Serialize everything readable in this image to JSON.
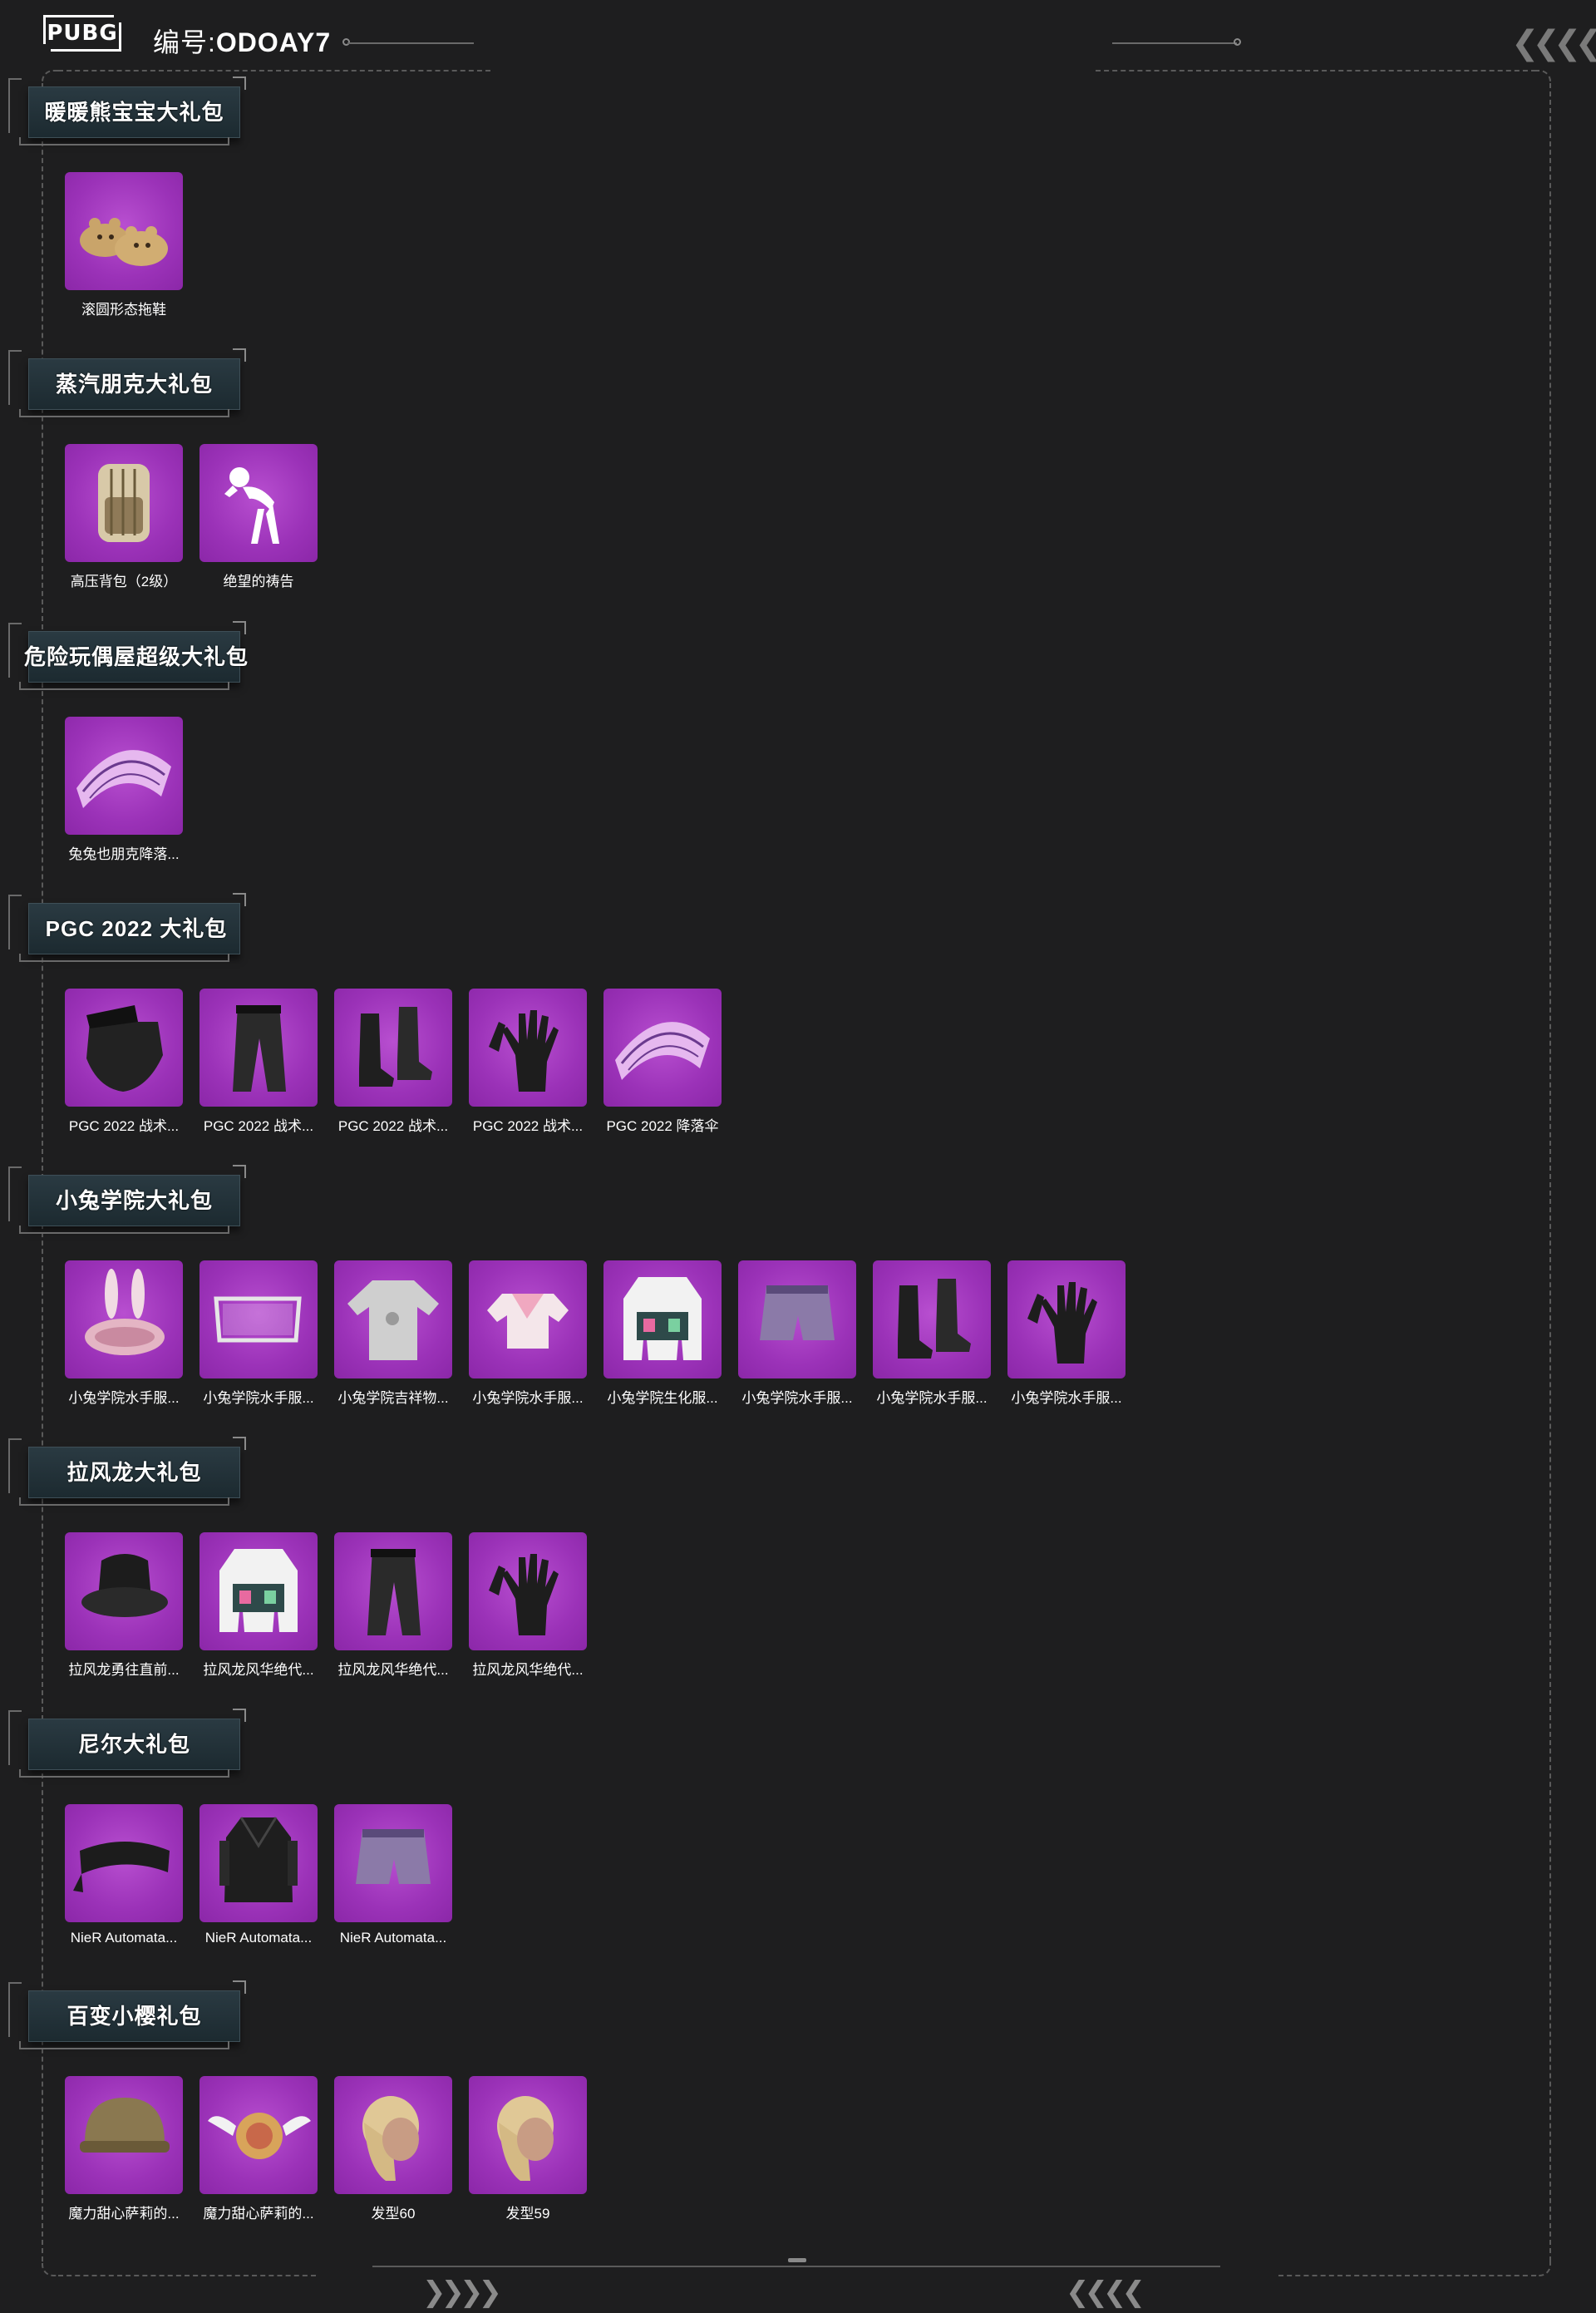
{
  "header": {
    "logo": "PUBG",
    "serial_label": "编号:",
    "serial_value": "ODOAY7"
  },
  "colors": {
    "background": "#1e1e1f",
    "item_bg": "#9b32b8",
    "section_header_bg": "#243239"
  },
  "sections": [
    {
      "title": "暖暖熊宝宝大礼包",
      "items": [
        {
          "label": "滚圆形态拖鞋",
          "icon": "slippers-icon"
        }
      ]
    },
    {
      "title": "蒸汽朋克大礼包",
      "items": [
        {
          "label": "高压背包（2级）",
          "icon": "backpack-icon"
        },
        {
          "label": "绝望的祷告",
          "icon": "emote-icon"
        }
      ]
    },
    {
      "title": "危险玩偶屋超级大礼包",
      "items": [
        {
          "label": "兔兔也朋克降落...",
          "icon": "parachute-icon"
        }
      ]
    },
    {
      "title": "PGC 2022 大礼包",
      "items": [
        {
          "label": "PGC 2022 战术...",
          "icon": "mask-icon"
        },
        {
          "label": "PGC 2022 战术...",
          "icon": "pants-icon"
        },
        {
          "label": "PGC 2022 战术...",
          "icon": "boots-icon"
        },
        {
          "label": "PGC 2022 战术...",
          "icon": "gloves-icon"
        },
        {
          "label": "PGC 2022 降落伞",
          "icon": "parachute-icon"
        }
      ]
    },
    {
      "title": "小兔学院大礼包",
      "items": [
        {
          "label": "小兔学院水手服...",
          "icon": "bunny-hat-icon"
        },
        {
          "label": "小兔学院水手服...",
          "icon": "glasses-icon"
        },
        {
          "label": "小兔学院吉祥物...",
          "icon": "shirt-icon"
        },
        {
          "label": "小兔学院水手服...",
          "icon": "top-icon"
        },
        {
          "label": "小兔学院生化服...",
          "icon": "jacket-icon"
        },
        {
          "label": "小兔学院水手服...",
          "icon": "shorts-icon"
        },
        {
          "label": "小兔学院水手服...",
          "icon": "boots-icon"
        },
        {
          "label": "小兔学院水手服...",
          "icon": "gloves-icon"
        }
      ]
    },
    {
      "title": "拉风龙大礼包",
      "items": [
        {
          "label": "拉风龙勇往直前...",
          "icon": "hat-icon"
        },
        {
          "label": "拉风龙风华绝代...",
          "icon": "jacket-icon"
        },
        {
          "label": "拉风龙风华绝代...",
          "icon": "pants-icon"
        },
        {
          "label": "拉风龙风华绝代...",
          "icon": "gloves-icon"
        }
      ]
    },
    {
      "title": "尼尔大礼包",
      "items": [
        {
          "label": "NieR Automata...",
          "icon": "blindfold-icon"
        },
        {
          "label": "NieR Automata...",
          "icon": "coat-icon"
        },
        {
          "label": "NieR Automata...",
          "icon": "shorts-icon"
        }
      ]
    },
    {
      "title": "百变小樱礼包",
      "items": [
        {
          "label": "魔力甜心萨莉的...",
          "icon": "helmet-icon"
        },
        {
          "label": "魔力甜心萨莉的...",
          "icon": "winged-shield-icon"
        },
        {
          "label": "发型60",
          "icon": "hairstyle-icon"
        },
        {
          "label": "发型59",
          "icon": "hairstyle-icon"
        }
      ]
    }
  ]
}
